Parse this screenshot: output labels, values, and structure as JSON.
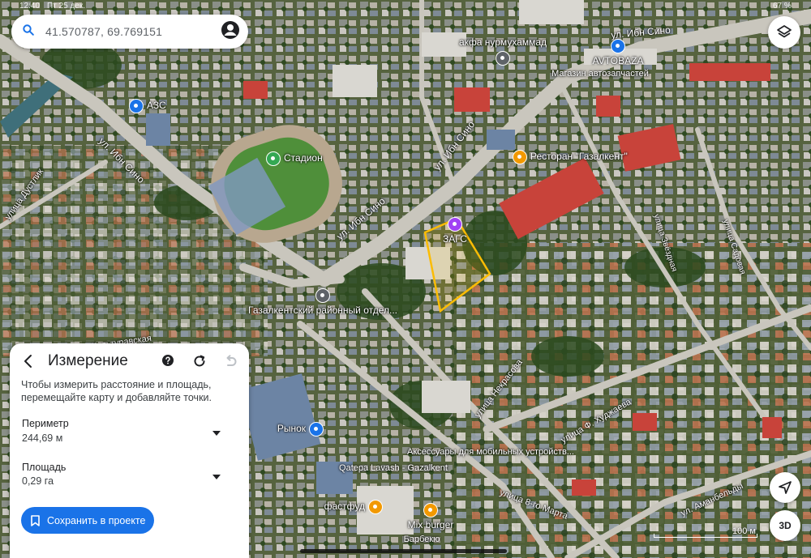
{
  "status_bar": {
    "time": "12:40",
    "date": "Пт 25 дек.",
    "battery": "67 %"
  },
  "search": {
    "query": "41.570787, 69.769151"
  },
  "map": {
    "roads": [
      {
        "name": "ул. Ибн Сино"
      },
      {
        "name": "ул. Ибн Сино"
      },
      {
        "name": "ул. Ибн Сино"
      },
      {
        "name": "ул. Ибн Сино"
      },
      {
        "name": "улица Дустлик"
      },
      {
        "name": "Культуравская"
      },
      {
        "name": "улица Некрасова"
      },
      {
        "name": "улица Ф. Худжаева"
      },
      {
        "name": "ул. Аманбельды"
      },
      {
        "name": "улица 8-го Марта"
      },
      {
        "name": "улица Звёздная"
      },
      {
        "name": "улица Садовая"
      }
    ],
    "places": [
      {
        "label": "Стадион",
        "icon": "stadium-icon",
        "color": "#34a853"
      },
      {
        "label": "ЗАГС",
        "icon": "rings-icon",
        "color": "#a142f4"
      },
      {
        "label": "АЗС",
        "icon": "fuel-icon",
        "color": "#1a73e8"
      },
      {
        "label": "акфа нурмухаммад",
        "icon": "pin-icon",
        "color": "#5f6368"
      },
      {
        "label": "AVTOBAZA",
        "icon": "shop-icon",
        "color": "#1a73e8"
      },
      {
        "label": "Магазин автозапчастей",
        "icon": "",
        "color": ""
      },
      {
        "label": "Ресторан \"Газалкент\"",
        "icon": "restaurant-icon",
        "color": "#f29900"
      },
      {
        "label": "Газалкентский районный отдел...",
        "icon": "pin-icon",
        "color": "#5f6368"
      },
      {
        "label": "Рынок",
        "icon": "cart-icon",
        "color": "#1a73e8"
      },
      {
        "label": "Аксессуары для мобильных устройств...",
        "icon": "",
        "color": ""
      },
      {
        "label": "Qatepa Lavash - Gazalkent",
        "icon": "",
        "color": ""
      },
      {
        "label": "фастфуд",
        "icon": "restaurant-icon",
        "color": "#f29900"
      },
      {
        "label": "Mix burger",
        "icon": "restaurant-icon",
        "color": "#f29900"
      },
      {
        "label": "Барбекю",
        "icon": "",
        "color": ""
      }
    ],
    "measure_color": "#fbbc04"
  },
  "measure": {
    "title": "Измерение",
    "hint": "Чтобы измерить расстояние и площадь, перемещайте карту и добавляйте точки.",
    "perimeter_label": "Периметр",
    "perimeter_value": "244,69 м",
    "area_label": "Площадь",
    "area_value": "0,29 га",
    "save_label": "Сохранить в проекте"
  },
  "controls": {
    "btn_3d": "3D",
    "scale_label": "100 м"
  },
  "colors": {
    "accent": "#1a73e8"
  }
}
